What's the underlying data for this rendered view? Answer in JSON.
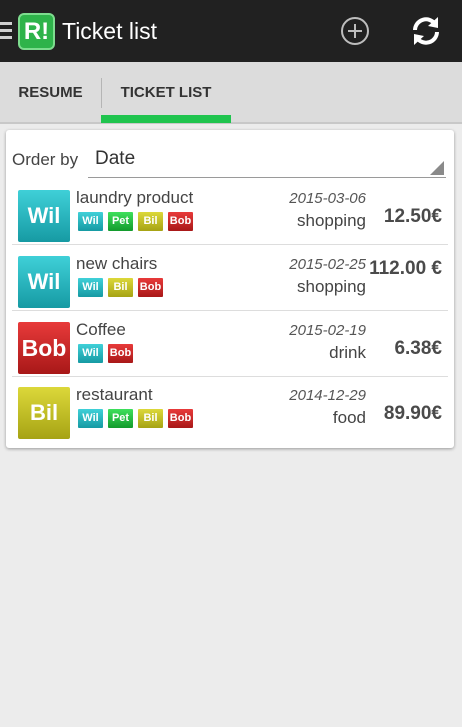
{
  "app": {
    "title": "Ticket list",
    "logo_text": "R!"
  },
  "actions": {
    "add_icon": "add-circle-icon",
    "refresh_icon": "refresh-icon"
  },
  "tabs": [
    {
      "label": "RESUME",
      "selected": false
    },
    {
      "label": "TICKET LIST",
      "selected": true
    }
  ],
  "sort": {
    "label": "Order by",
    "value": "Date"
  },
  "colors": {
    "wil": "#2cb8c1",
    "pet": "#2bc74a",
    "bil": "#c4c124",
    "bob": "#c82626",
    "accent": "#1fc44e"
  },
  "tickets": [
    {
      "payer": "Wil",
      "name": "laundry product",
      "tags": [
        "Wil",
        "Pet",
        "Bil",
        "Bob"
      ],
      "date": "2015-03-06",
      "category": "shopping",
      "amount": "12.50€"
    },
    {
      "payer": "Wil",
      "name": "new chairs",
      "tags": [
        "Wil",
        "Bil",
        "Bob"
      ],
      "date": "2015-02-25",
      "category": "shopping",
      "amount": "112.00 €"
    },
    {
      "payer": "Bob",
      "name": "Coffee",
      "tags": [
        "Wil",
        "Bob"
      ],
      "date": "2015-02-19",
      "category": "drink",
      "amount": "6.38€"
    },
    {
      "payer": "Bil",
      "name": "restaurant",
      "tags": [
        "Wil",
        "Pet",
        "Bil",
        "Bob"
      ],
      "date": "2014-12-29",
      "category": "food",
      "amount": "89.90€"
    }
  ]
}
